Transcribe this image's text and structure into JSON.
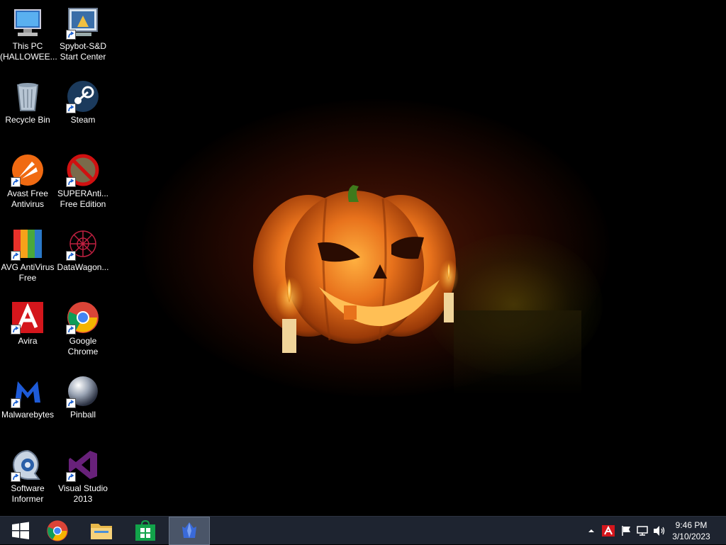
{
  "desktop": {
    "icons": [
      {
        "label": "This PC\n(HALLOWEE...",
        "icon": "computer-icon"
      },
      {
        "label": "Spybot-S&D\nStart Center",
        "icon": "spybot-icon"
      },
      {
        "label": "Recycle Bin",
        "icon": "recycle-bin-icon"
      },
      {
        "label": "Steam",
        "icon": "steam-icon"
      },
      {
        "label": "Avast Free\nAntivirus",
        "icon": "avast-icon"
      },
      {
        "label": "SUPERAnti...\nFree Edition",
        "icon": "superantispyware-icon"
      },
      {
        "label": "AVG AntiVirus\nFree",
        "icon": "avg-icon"
      },
      {
        "label": "DataWagon...",
        "icon": "datawagon-icon"
      },
      {
        "label": "Avira",
        "icon": "avira-icon"
      },
      {
        "label": "Google\nChrome",
        "icon": "chrome-icon"
      },
      {
        "label": "Malwarebytes",
        "icon": "malwarebytes-icon"
      },
      {
        "label": "Pinball",
        "icon": "pinball-icon"
      },
      {
        "label": "Software\nInformer",
        "icon": "software-informer-icon"
      },
      {
        "label": "Visual Studio\n2013",
        "icon": "visual-studio-icon"
      }
    ]
  },
  "taskbar": {
    "pinned": [
      "start",
      "chrome",
      "file-explorer",
      "store",
      "active-app"
    ],
    "tray": [
      "show-hidden-icons",
      "avira-tray",
      "action-center-flag",
      "network",
      "volume"
    ],
    "clock": {
      "time": "9:46 PM",
      "date": "3/10/2023"
    }
  },
  "colors": {
    "taskbar": "#1e2430",
    "active_button": "#4a5568",
    "pumpkin": "#e8721c",
    "desktop": "#000000"
  }
}
